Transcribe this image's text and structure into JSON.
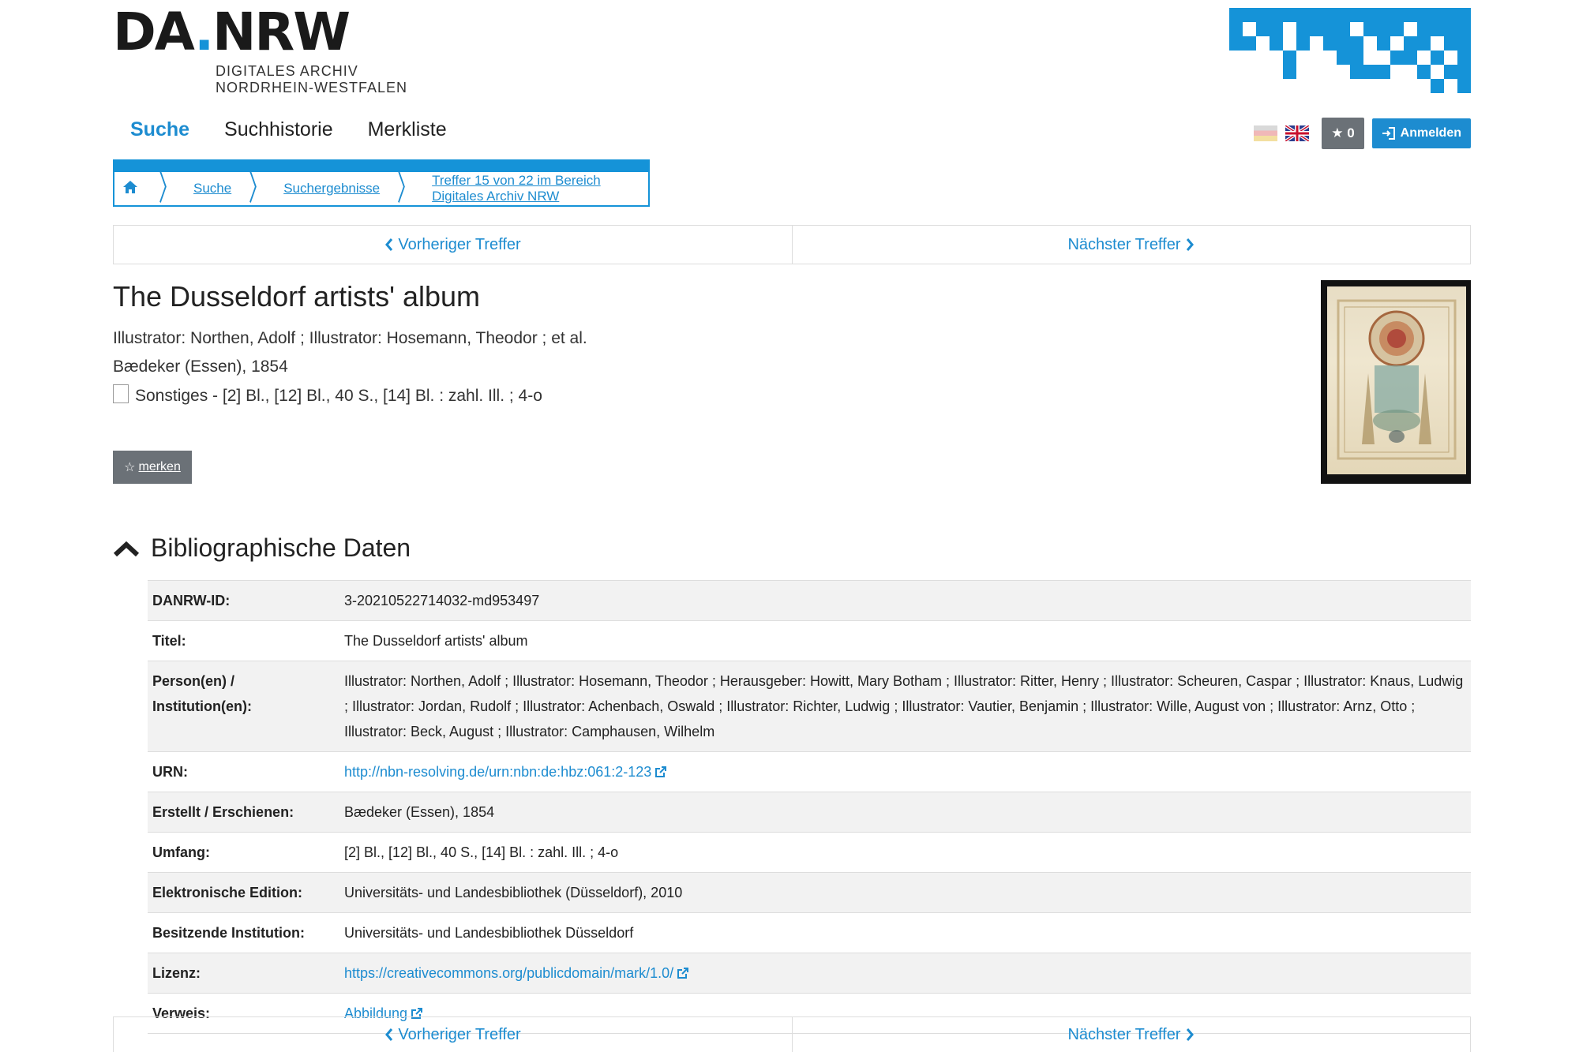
{
  "logo": {
    "main_left": "DA",
    "main_dot": ".",
    "main_right": "NRW",
    "sub_line1": "DIGITALES ARCHIV",
    "sub_line2": "NORDRHEIN-WESTFALEN"
  },
  "nav": {
    "items": [
      "Suche",
      "Suchhistorie",
      "Merkliste"
    ],
    "active": "Suche"
  },
  "toolbar": {
    "star_count": "0",
    "login_label": "Anmelden"
  },
  "breadcrumb": {
    "items": [
      "Suche",
      "Suchergebnisse",
      "Treffer 15 von 22 im Bereich Digitales Archiv NRW"
    ]
  },
  "pager": {
    "prev_label": "Vorheriger Treffer",
    "next_label": "Nächster Treffer"
  },
  "record": {
    "title": "The Dusseldorf artists' album",
    "persons": "Illustrator: Northen, Adolf ; Illustrator: Hosemann, Theodor ; et al.",
    "publisher": "Bædeker (Essen), 1854",
    "format": "Sonstiges - [2] Bl., [12] Bl., 40 S., [14] Bl. : zahl. Ill. ; 4-o",
    "bookmark_label": "merken"
  },
  "bib": {
    "heading": "Bibliographische Daten",
    "rows": [
      {
        "label": "DANRW-ID:",
        "value": "3-20210522714032-md953497"
      },
      {
        "label": "Titel:",
        "value": "The Dusseldorf artists' album"
      },
      {
        "label": "Person(en) / Institution(en):",
        "value": "Illustrator: Northen, Adolf ; Illustrator: Hosemann, Theodor ; Herausgeber: Howitt, Mary Botham ; Illustrator: Ritter, Henry ; Illustrator: Scheuren, Caspar ; Illustrator: Knaus, Ludwig ; Illustrator: Jordan, Rudolf ; Illustrator: Achenbach, Oswald ; Illustrator: Richter, Ludwig ; Illustrator: Vautier, Benjamin ; Illustrator: Wille, August von ; Illustrator: Arnz, Otto ; Illustrator: Beck, August ; Illustrator: Camphausen, Wilhelm"
      },
      {
        "label": "URN:",
        "value": "http://nbn-resolving.de/urn:nbn:de:hbz:061:2-123"
      },
      {
        "label": "Erstellt / Erschienen:",
        "value": "Bædeker (Essen), 1854"
      },
      {
        "label": "Umfang:",
        "value": "[2] Bl., [12] Bl., 40 S., [14] Bl. : zahl. Ill. ; 4-o"
      },
      {
        "label": "Elektronische Edition:",
        "value": "Universitäts- und Landesbibliothek (Düsseldorf), 2010"
      },
      {
        "label": "Besitzende Institution:",
        "value": "Universitäts- und Landesbibliothek Düsseldorf"
      },
      {
        "label": "Lizenz:",
        "value": "https://creativecommons.org/publicdomain/mark/1.0/"
      },
      {
        "label": "Verweis:",
        "value": "Abbildung"
      }
    ]
  },
  "colors": {
    "accent": "#1d8cd0",
    "brand_blue": "#1593d8",
    "button_gray": "#6b7177"
  },
  "icons": [
    "home-icon",
    "chevron-left-icon",
    "chevron-right-icon",
    "star-icon",
    "login-icon",
    "document-icon",
    "external-link-icon",
    "chevron-up-icon"
  ]
}
